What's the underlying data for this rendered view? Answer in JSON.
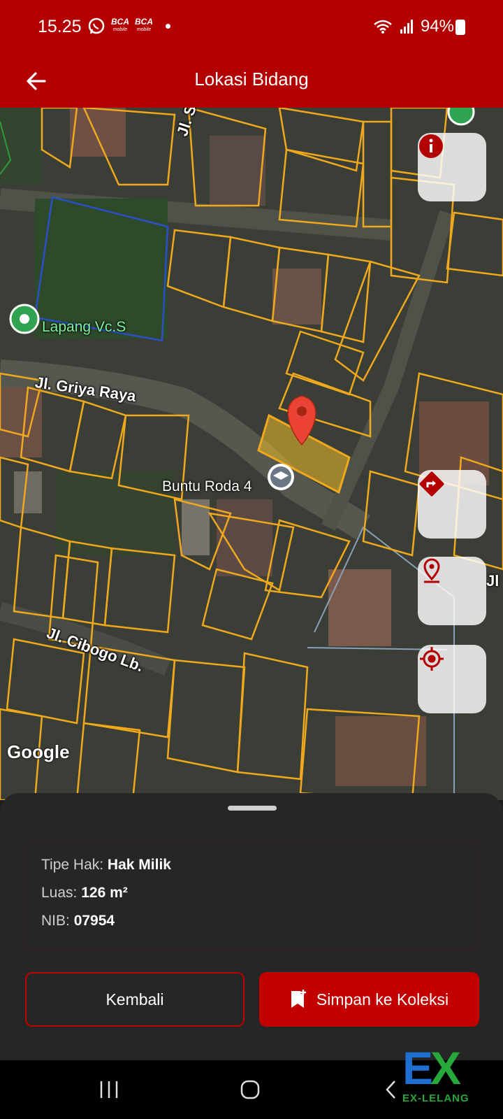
{
  "status_bar": {
    "time": "15.25",
    "battery": "94%",
    "notification_badges": [
      "BCA",
      "BCA"
    ],
    "badge_sub": "mobile"
  },
  "app_bar": {
    "title": "Lokasi Bidang",
    "back_icon": "arrow-left-icon"
  },
  "map": {
    "streets": {
      "griya_raya": "Jl. Griya Raya",
      "cibogo": "Jl. Cibogo Lb.",
      "top_street": "Jl. Sa",
      "right_street": "Jl"
    },
    "pois": {
      "lapang": "Lapang Vc.S",
      "buntu": "Buntu Roda 4"
    },
    "attribution": "Google",
    "buttons": [
      "info-icon",
      "directions-icon",
      "location-pin-icon",
      "my-location-icon"
    ]
  },
  "sheet": {
    "fields": [
      {
        "label": "Tipe Hak: ",
        "value": "Hak Milik"
      },
      {
        "label": "Luas: ",
        "value": "126 m²"
      },
      {
        "label": "NIB: ",
        "value": "07954"
      }
    ],
    "back_button": "Kembali",
    "save_button": "Simpan ke Koleksi"
  },
  "watermark": {
    "logo_letters": "EX",
    "text": "EX-LELANG"
  },
  "colors": {
    "primary": "#b30000",
    "parcel_outline": "#f0a91c",
    "sheet_bg": "#262626",
    "button_red": "#c20000"
  }
}
